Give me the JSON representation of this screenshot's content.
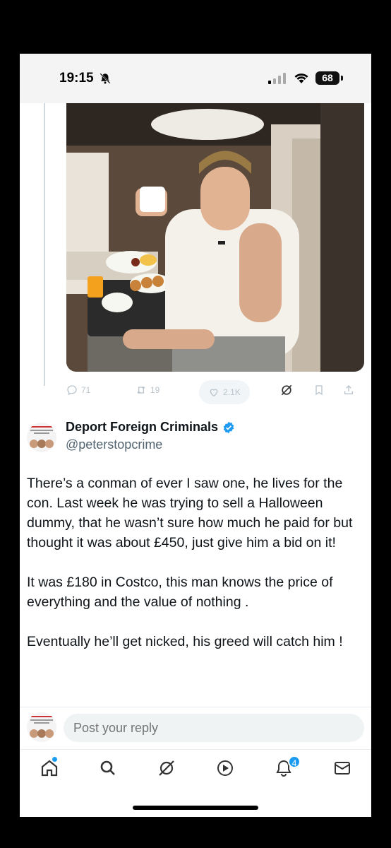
{
  "status_bar": {
    "time": "19:15",
    "battery": "68"
  },
  "post": {
    "stats": {
      "replies": "71",
      "reposts": "19",
      "likes": "2.1K"
    },
    "author": {
      "name": "Deport Foreign Criminals",
      "handle": "@peterstopcrime"
    },
    "body": "There’s a conman of ever I saw one, he lives for the con.  Last week he was trying to sell a Halloween dummy, that he wasn’t sure how much he paid  for but thought it was about £450, just give him a bid on it!\n\nIt was £180 in Costco, this man knows the price of everything and the value of nothing .\n\nEventually he’ll get nicked, his greed will catch him !"
  },
  "reply": {
    "placeholder": "Post your reply"
  },
  "tabs": [
    {
      "icon": "home-icon"
    },
    {
      "icon": "search-icon"
    },
    {
      "icon": "grok-icon"
    },
    {
      "icon": "video-icon"
    },
    {
      "icon": "bell-icon",
      "badge": "4"
    },
    {
      "icon": "mail-icon"
    }
  ],
  "colors": {
    "accent": "#1d9bf0",
    "text": "#0f1419",
    "muted": "#536471"
  }
}
